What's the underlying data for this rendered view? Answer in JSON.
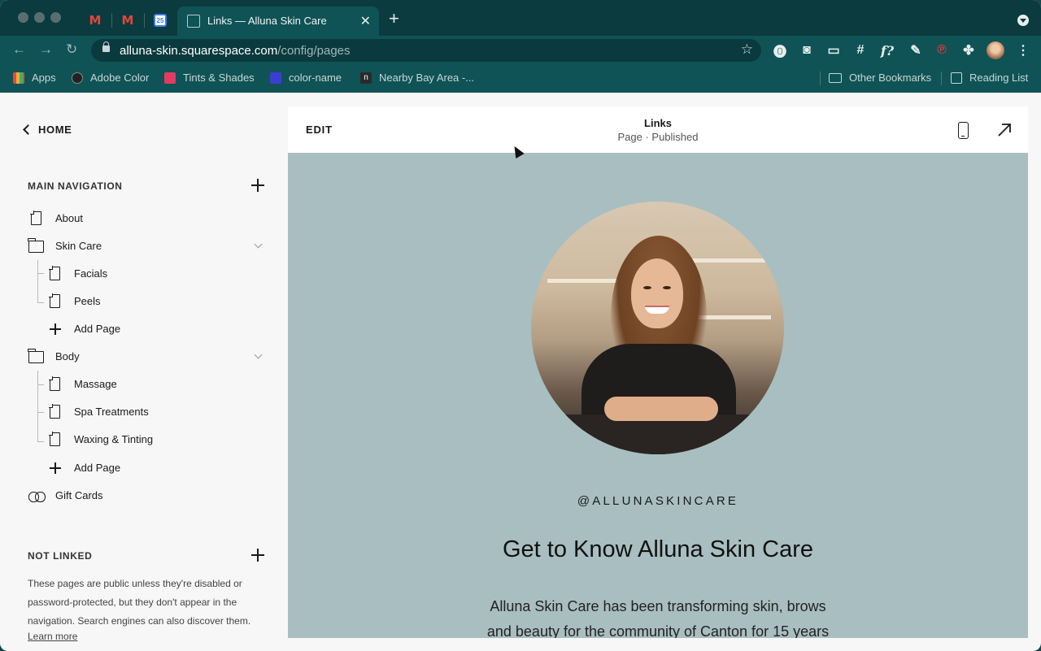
{
  "browser": {
    "active_tab_title": "Links — Alluna Skin Care",
    "url_host": "alluna-skin.squarespace.com",
    "url_path": "/config/pages",
    "calendar_day": "25",
    "bookmarks": [
      {
        "label": "Apps",
        "color": "#f2a93b"
      },
      {
        "label": "Adobe Color",
        "color": "#222222"
      },
      {
        "label": "Tints & Shades",
        "color": "#e23b62"
      },
      {
        "label": "color-name",
        "color": "#3b3fd1"
      },
      {
        "label": "Nearby Bay Area -...",
        "color": "#2a2a2a"
      }
    ],
    "other_bookmarks": "Other Bookmarks",
    "reading_list": "Reading List"
  },
  "sidebar": {
    "home": "HOME",
    "main_navigation": "MAIN NAVIGATION",
    "items": [
      {
        "label": "About",
        "icon": "page-icon"
      },
      {
        "label": "Skin Care",
        "icon": "folder-icon"
      },
      {
        "label": "Facials",
        "icon": "page-icon"
      },
      {
        "label": "Peels",
        "icon": "page-icon"
      },
      {
        "label": "Add Page",
        "icon": "plus-icon"
      },
      {
        "label": "Body",
        "icon": "folder-icon"
      },
      {
        "label": "Massage",
        "icon": "page-icon"
      },
      {
        "label": "Spa Treatments",
        "icon": "page-icon"
      },
      {
        "label": "Waxing & Tinting",
        "icon": "page-icon"
      },
      {
        "label": "Add Page",
        "icon": "plus-icon"
      },
      {
        "label": "Gift Cards",
        "icon": "link-icon"
      }
    ],
    "not_linked": "NOT LINKED",
    "not_linked_desc": "These pages are public unless they're disabled or password-protected, but they don't appear in the navigation. Search engines can also discover them.",
    "learn_more": "Learn more"
  },
  "preview": {
    "edit": "EDIT",
    "page_name": "Links",
    "page_status": "Page · Published",
    "handle": "@ALLUNASKINCARE",
    "headline": "Get to Know Alluna Skin Care",
    "body": "Alluna Skin Care has been transforming skin, brows and beauty for the community of Canton for 15 years"
  }
}
